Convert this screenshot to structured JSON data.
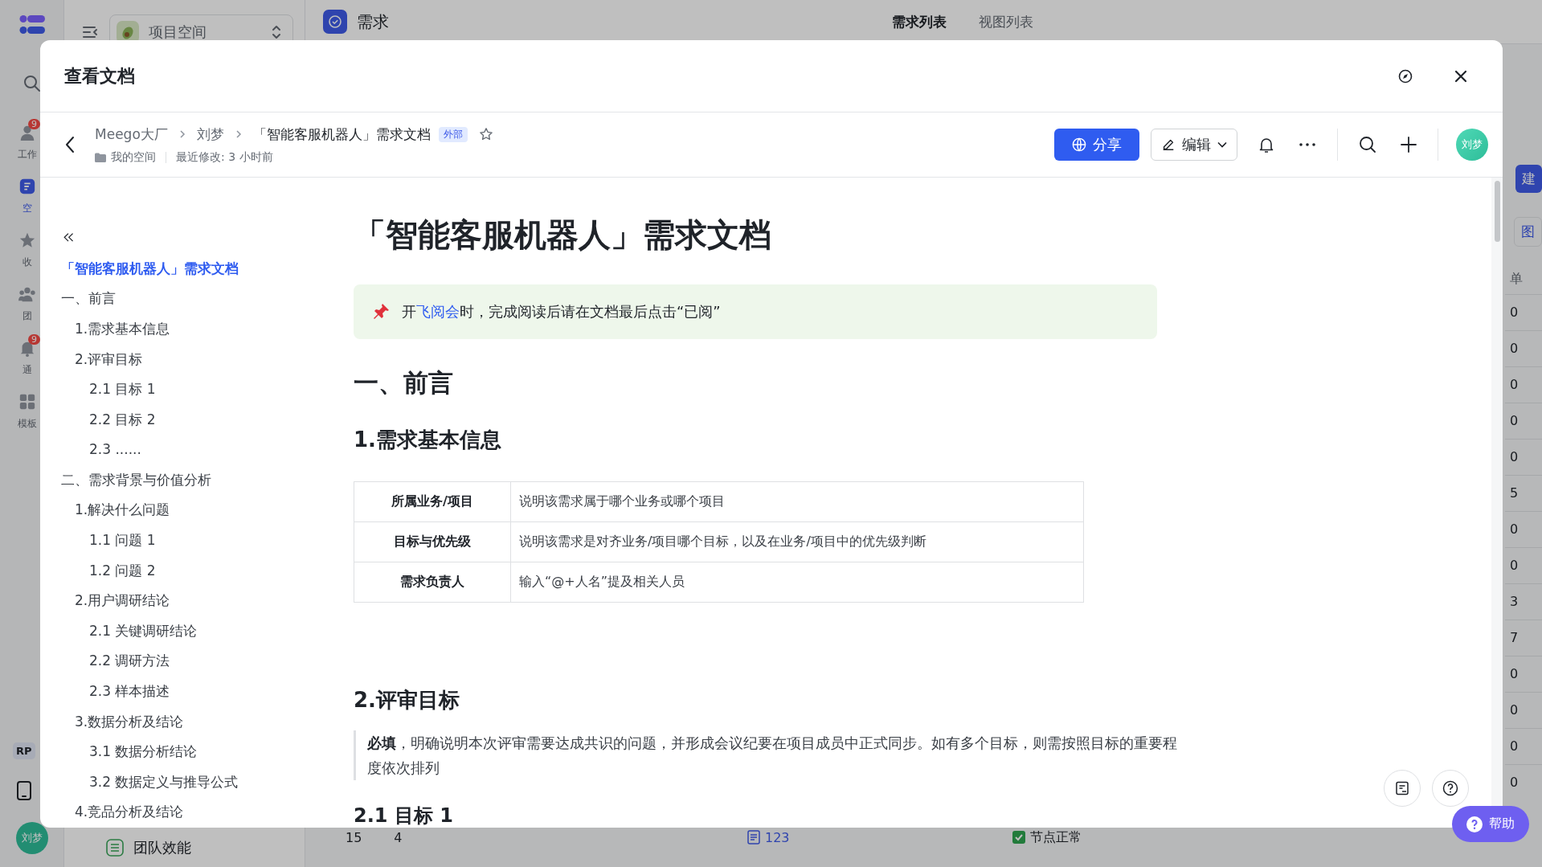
{
  "app": {
    "rail": {
      "items": [
        {
          "label": "工作",
          "badge": "9",
          "selected": false
        },
        {
          "label": "空",
          "selected": true
        },
        {
          "label": "收",
          "selected": false
        },
        {
          "label": "团",
          "selected": false
        },
        {
          "label": "通",
          "badge": "9",
          "selected": false
        },
        {
          "label": "模板",
          "selected": false
        }
      ],
      "chip": "RP",
      "user": "刘梦"
    },
    "project_switcher": {
      "label": "项目空间"
    },
    "sidebar_bottom": {
      "label": "团队效能"
    },
    "header": {
      "title": "需求",
      "tabs": [
        {
          "label": "需求列表",
          "selected": true
        },
        {
          "label": "视图列表",
          "selected": false
        }
      ]
    },
    "right_edge": {
      "buttons": [
        {
          "label": "建",
          "kind": "primary"
        },
        {
          "label": "图",
          "kind": "outline"
        }
      ],
      "column_header": "单",
      "cells": [
        "0",
        "0",
        "0",
        "0",
        "0",
        "5",
        "0",
        "0",
        "3",
        "7",
        "0",
        "0",
        "0",
        "0"
      ]
    },
    "bottom_row": {
      "cells": [
        "15",
        "4"
      ],
      "link": "123",
      "status": "节点正常"
    }
  },
  "modal": {
    "title": "查看文档",
    "breadcrumb": [
      "Meego大厂",
      "刘梦",
      "「智能客服机器人」需求文档"
    ],
    "badge": "外部",
    "starred": false,
    "location": "我的空间",
    "modified": "最近修改: 3 小时前",
    "share": "分享",
    "edit": "编辑",
    "avatar": "刘梦",
    "outline": [
      {
        "label": "「智能客服机器人」需求文档",
        "selected": true
      },
      {
        "label": "一、前言",
        "selected": false,
        "children": [
          {
            "label": "1.需求基本信息",
            "selected": false
          },
          {
            "label": "2.评审目标",
            "selected": false,
            "children": [
              {
                "label": "2.1 目标 1",
                "selected": false
              },
              {
                "label": "2.2 目标 2",
                "selected": false
              },
              {
                "label": "2.3 ......",
                "selected": false
              }
            ]
          }
        ]
      },
      {
        "label": "二、需求背景与价值分析",
        "selected": false,
        "children": [
          {
            "label": "1.解决什么问题",
            "selected": false,
            "children": [
              {
                "label": "1.1 问题 1",
                "selected": false
              },
              {
                "label": "1.2 问题 2",
                "selected": false
              }
            ]
          },
          {
            "label": "2.用户调研结论",
            "selected": false,
            "children": [
              {
                "label": "2.1 关键调研结论",
                "selected": false
              },
              {
                "label": "2.2 调研方法",
                "selected": false
              },
              {
                "label": "2.3 样本描述",
                "selected": false
              }
            ]
          },
          {
            "label": "3.数据分析及结论",
            "selected": false,
            "children": [
              {
                "label": "3.1 数据分析结论",
                "selected": false
              },
              {
                "label": "3.2 数据定义与推导公式",
                "selected": false
              }
            ]
          },
          {
            "label": "4.竞品分析及结论",
            "selected": false
          }
        ]
      }
    ],
    "document": {
      "title": "「智能客服机器人」需求文档",
      "blocks": [
        {
          "kind": "callout",
          "before": "开",
          "link": "飞阅会",
          "after": "时，完成阅读后请在文档最后点击“已阅”"
        },
        {
          "kind": "h1",
          "text": "一、前言"
        },
        {
          "kind": "h2",
          "text": "1.需求基本信息"
        },
        {
          "kind": "table",
          "rows": [
            [
              "所属业务/项目",
              "说明该需求属于哪个业务或哪个项目"
            ],
            [
              "目标与优先级",
              "说明该需求是对齐业务/项目哪个目标，以及在业务/项目中的优先级判断"
            ],
            [
              "需求负责人",
              "输入“@+人名”提及相关人员"
            ]
          ]
        },
        {
          "kind": "h2",
          "text": "2.评审目标"
        },
        {
          "kind": "quote",
          "text": "**必填**，明确说明本次评审需要达成共识的问题，并形成会议纪要在项目成员中正式同步。如有多个目标，则需按照目标的重要程度依次排列"
        },
        {
          "kind": "h3",
          "text": "2.1 目标 1"
        }
      ]
    }
  },
  "help": "帮助"
}
